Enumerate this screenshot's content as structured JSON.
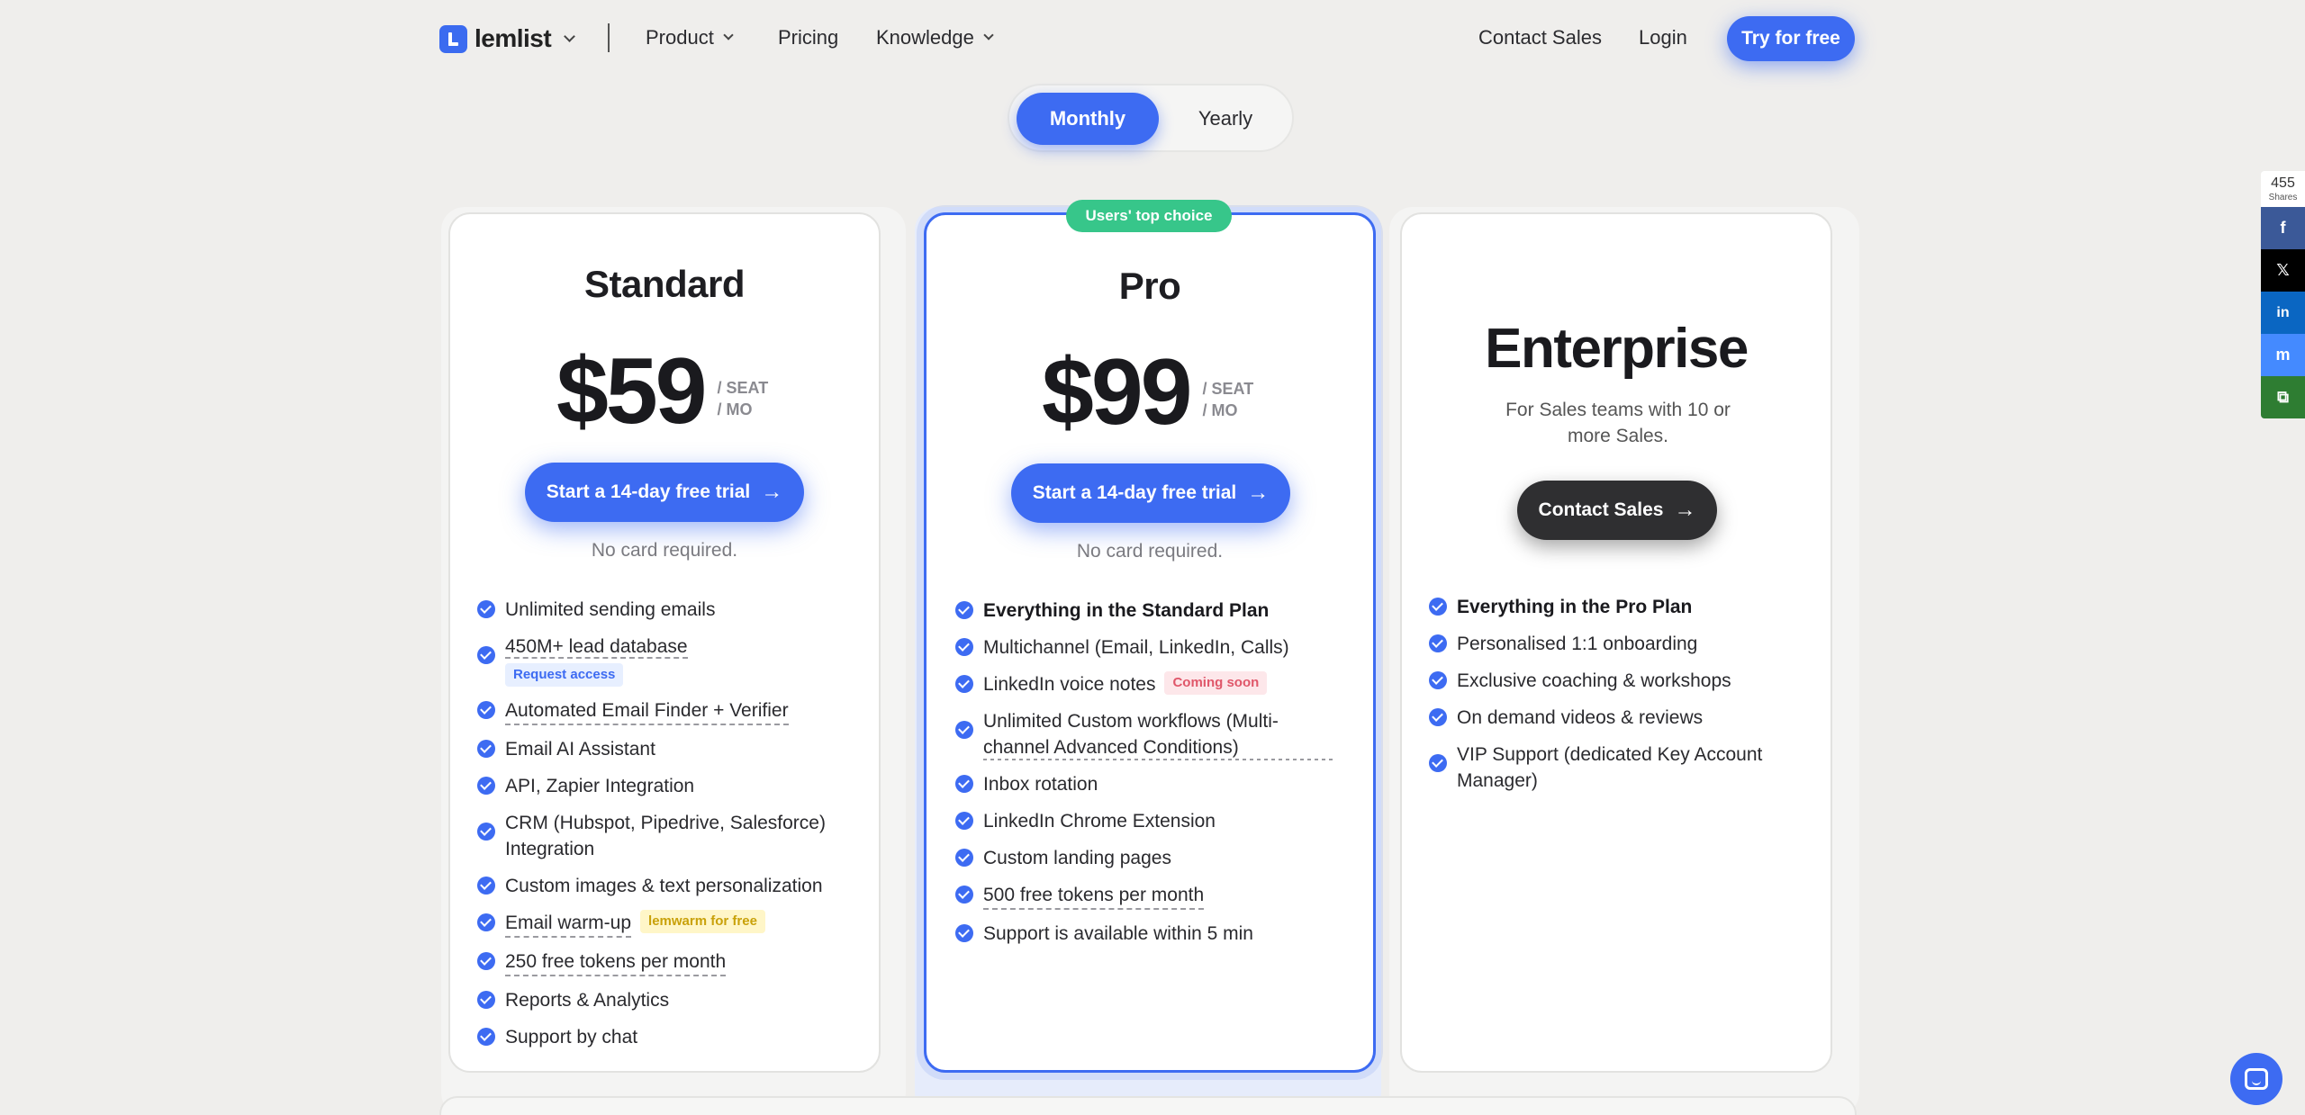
{
  "nav": {
    "logo_text": "lemlist",
    "product": "Product",
    "pricing": "Pricing",
    "knowledge": "Knowledge",
    "contact_sales": "Contact Sales",
    "login": "Login",
    "try_free": "Try for free"
  },
  "billing_toggle": {
    "monthly": "Monthly",
    "yearly": "Yearly"
  },
  "plans": {
    "standard": {
      "title": "Standard",
      "price": "$59",
      "per_seat": "/ SEAT",
      "per_mo": "/ MO",
      "cta": "Start a 14-day free trial",
      "note": "No card required.",
      "features": [
        "Unlimited sending emails",
        "450M+ lead database",
        "Automated Email Finder + Verifier",
        "Email AI Assistant",
        "API, Zapier Integration",
        "CRM (Hubspot, Pipedrive, Salesforce) Integration",
        "Custom images & text personalization",
        "Email warm-up",
        "250 free tokens per month",
        "Reports & Analytics",
        "Support by chat"
      ],
      "tag_request_access": "Request access",
      "tag_lemwarm": "lemwarm for free"
    },
    "pro": {
      "badge": "Users' top choice",
      "title": "Pro",
      "price": "$99",
      "per_seat": "/ SEAT",
      "per_mo": "/ MO",
      "cta": "Start a 14-day free trial",
      "note": "No card required.",
      "features": [
        "Everything in the Standard Plan",
        "Multichannel (Email, LinkedIn, Calls)",
        "LinkedIn voice notes",
        "Unlimited Custom workflows (Multi-channel Advanced Conditions)",
        "Inbox rotation",
        "LinkedIn Chrome Extension",
        "Custom landing pages",
        "500 free tokens per month",
        "Support is available within 5 min"
      ],
      "tag_coming_soon": "Coming soon"
    },
    "enterprise": {
      "title": "Enterprise",
      "subtitle": "For Sales teams with 10 or more Sales.",
      "cta": "Contact Sales",
      "features": [
        "Everything in the Pro Plan",
        "Personalised 1:1 onboarding",
        "Exclusive coaching & workshops",
        "On demand videos & reviews",
        "VIP Support (dedicated Key Account Manager)"
      ]
    }
  },
  "share_bar": {
    "count": "455",
    "count_label": "Shares",
    "facebook": "f",
    "x": "𝕏",
    "linkedin": "in",
    "messenger": "m",
    "copy": "⧉",
    "colors": {
      "facebook": "#3b5998",
      "x": "#000000",
      "linkedin": "#0a66c2",
      "messenger": "#448aff",
      "copy": "#2e7d32"
    }
  },
  "colors": {
    "accent": "#3d6bf2",
    "badge_green": "#37c68a",
    "dark_button": "#2f2f31"
  }
}
